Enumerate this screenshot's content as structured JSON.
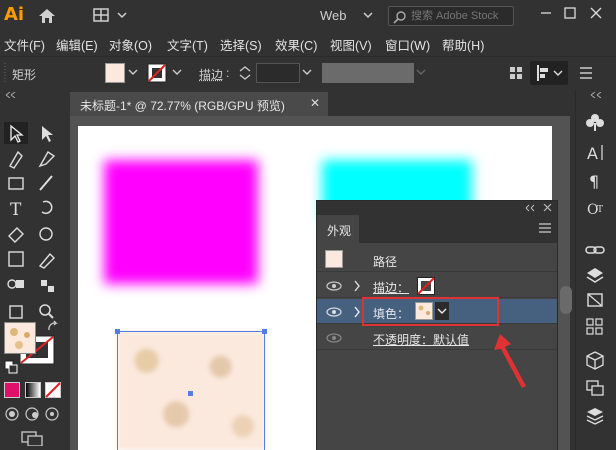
{
  "app": {
    "logo_text": "Ai",
    "workspace": "Web",
    "search_placeholder": "搜索 Adobe Stock"
  },
  "menu": [
    "文件(F)",
    "编辑(E)",
    "对象(O)",
    "文字(T)",
    "选择(S)",
    "效果(C)",
    "视图(V)",
    "窗口(W)",
    "帮助(H)"
  ],
  "control_bar": {
    "object_type": "矩形",
    "stroke_label": "描边",
    "stroke_colon": ":"
  },
  "document": {
    "tab_title": "未标题-1* @ 72.77% (RGB/GPU 预览)",
    "tab_close": "✕"
  },
  "appearance_panel": {
    "tab": "外观",
    "rows": [
      {
        "label": "路径"
      },
      {
        "label": "描边："
      },
      {
        "label": "填色：",
        "selected": true
      },
      {
        "label": "不透明度：默认值"
      }
    ]
  },
  "colors": {
    "magenta": "#ff00ff",
    "cyan": "#00ffff",
    "selection": "#4f7fe0",
    "highlight": "#e03232"
  }
}
